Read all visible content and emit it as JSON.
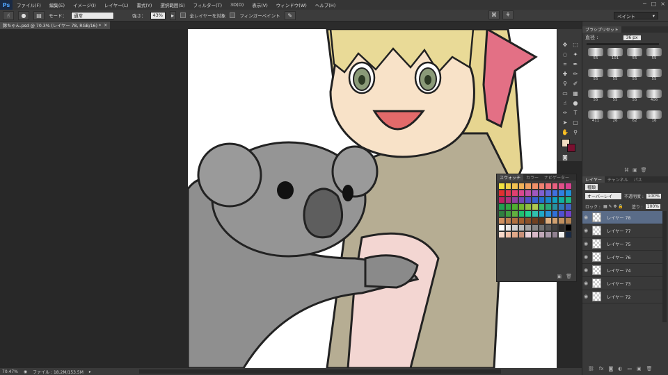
{
  "app": {
    "logo": "Ps"
  },
  "menu": [
    "ファイル(F)",
    "編集(E)",
    "イメージ(I)",
    "レイヤー(L)",
    "書式(Y)",
    "選択範囲(S)",
    "フィルター(T)",
    "3D(D)",
    "表示(V)",
    "ウィンドウ(W)",
    "ヘルプ(H)"
  ],
  "window_controls": [
    "−",
    "□",
    "×"
  ],
  "options": {
    "mode_label": "モード：",
    "mode_value": "通常",
    "strength_label": "強さ：",
    "strength_value": "43%",
    "all_layers_label": "全レイヤーを対象",
    "finger_paint_label": "フィンガーペイント",
    "workspace": "ペイント"
  },
  "document": {
    "tab_title": "豚ちゃん.psd @ 70.3% (レイヤー 78, RGB/16) *",
    "tab_close": "×"
  },
  "status": {
    "zoom": "70.47%",
    "file_info": "ファイル : 18.2M/153.5M"
  },
  "brush_panel": {
    "tab": "ブラシプリセット",
    "size_label": "直径 :",
    "size_value": "36 px",
    "brushes": [
      {
        "size": "55"
      },
      {
        "size": "101"
      },
      {
        "size": "55"
      },
      {
        "size": "55"
      },
      {
        "size": "55"
      },
      {
        "size": "55"
      },
      {
        "size": "55"
      },
      {
        "size": "55"
      },
      {
        "size": "55"
      },
      {
        "size": "55"
      },
      {
        "size": "55"
      },
      {
        "size": "406"
      },
      {
        "size": "411"
      },
      {
        "size": "26"
      },
      {
        "size": "62"
      },
      {
        "size": "16"
      }
    ]
  },
  "swatch_panel": {
    "tabs": [
      "スウォッチ",
      "カラー",
      "ナビゲーター"
    ],
    "colors": [
      "#f0e040",
      "#f0d048",
      "#f0c050",
      "#f0b058",
      "#f0a060",
      "#f09068",
      "#f08070",
      "#f07078",
      "#e86080",
      "#e05088",
      "#d84090",
      "#e03030",
      "#e03850",
      "#e04070",
      "#d84890",
      "#c050a8",
      "#a058c0",
      "#8060d0",
      "#6068d8",
      "#4070e0",
      "#3080e0",
      "#2090d8",
      "#c02060",
      "#b03080",
      "#9040a0",
      "#7048b8",
      "#5050c8",
      "#3860d0",
      "#2070d0",
      "#1888c8",
      "#10a0c0",
      "#10b0a0",
      "#20b880",
      "#20a050",
      "#30a840",
      "#50b030",
      "#70b830",
      "#90c040",
      "#b0c850",
      "#38b868",
      "#28a878",
      "#2890a0",
      "#3078b8",
      "#4060c0",
      "#308040",
      "#40a040",
      "#60b040",
      "#20c070",
      "#20d090",
      "#30c0b0",
      "#20a8c8",
      "#2890d8",
      "#3070d8",
      "#5050d0",
      "#7040c8",
      "#d09060",
      "#c08050",
      "#b07040",
      "#a06030",
      "#8a5028",
      "#704020",
      "#5a3418",
      "#e0b080",
      "#d0a070",
      "#c09060",
      "#b08050",
      "#ffffff",
      "#e8e8e8",
      "#d0d0d0",
      "#b8b8b8",
      "#a0a0a0",
      "#888888",
      "#707070",
      "#585858",
      "#404040",
      "#282828",
      "#000000",
      "#f8d8c8",
      "#f0c0a8",
      "#e0a888",
      "#c89078",
      "#e8d0d8",
      "#d8b8c8",
      "#c0a8b8",
      "#a898a8",
      "#908090",
      "#f0f0f0",
      "#1a2a44"
    ]
  },
  "layer_panel": {
    "tabs": [
      "レイヤー",
      "チャンネル",
      "パス"
    ],
    "kind": "種類",
    "blend_mode": "オーバーレイ",
    "opacity_label": "不透明度 :",
    "opacity_value": "100%",
    "lock_label": "ロック :",
    "fill_label": "塗り :",
    "fill_value": "100%",
    "layers": [
      {
        "name": "レイヤー 78",
        "selected": true
      },
      {
        "name": "レイヤー 77"
      },
      {
        "name": "レイヤー 75"
      },
      {
        "name": "レイヤー 76"
      },
      {
        "name": "レイヤー 74"
      },
      {
        "name": "レイヤー 73"
      },
      {
        "name": "レイヤー 72"
      }
    ]
  }
}
